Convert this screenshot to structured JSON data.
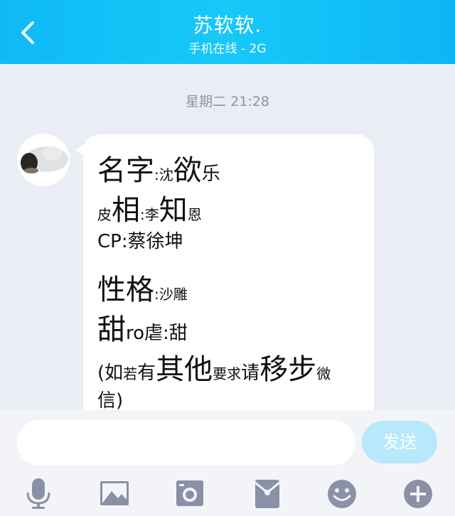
{
  "header": {
    "title": "苏软软.",
    "status": "手机在线 - 2G"
  },
  "chat": {
    "timestamp": "星期二 21:28",
    "message": {
      "line1": {
        "a": "名字",
        "b": ":",
        "c": "沈",
        "d": "欲",
        "e": "乐"
      },
      "line2": {
        "a": "皮",
        "b": "相",
        "c": ":",
        "d": "李",
        "e": "知",
        "f": "恩"
      },
      "line3": {
        "a": "CP",
        "b": ":",
        "c": "蔡徐坤"
      },
      "line4": {
        "a": "性格",
        "b": ":",
        "c": "沙雕"
      },
      "line5": {
        "a": "甜",
        "b": "ro虐",
        "c": ":",
        "d": "甜"
      },
      "line6": {
        "a": "(如",
        "b": "若",
        "c": "有",
        "d": "其他",
        "e": "要求",
        "f": "请",
        "g": "移步",
        "h": "微"
      },
      "line7": {
        "a": "信)"
      }
    }
  },
  "composer": {
    "placeholder": "",
    "send_label": "发送"
  },
  "toolbar": {
    "icons": [
      "microphone-icon",
      "image-icon",
      "camera-icon",
      "red-packet-icon",
      "emoji-icon",
      "plus-icon"
    ]
  },
  "colors": {
    "header": "#17c8f8",
    "background": "#eaedf4",
    "send_button": "#b8e8fb",
    "toolbar_icon": "#8a90a6"
  }
}
